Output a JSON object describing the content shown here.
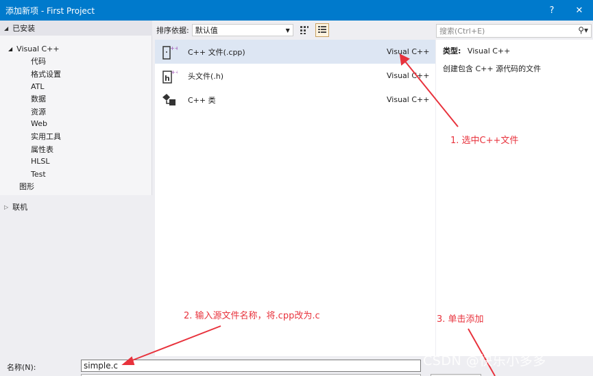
{
  "window": {
    "title": "添加新项 - First Project",
    "help_label": "?",
    "close_label": "✕"
  },
  "left_panel": {
    "installed_label": "已安装",
    "tree": {
      "root": "Visual C++",
      "children": [
        "代码",
        "格式设置",
        "ATL",
        "数据",
        "资源",
        "Web",
        "实用工具",
        "属性表",
        "HLSL",
        "Test"
      ],
      "graphics": "图形"
    },
    "online_label": "联机"
  },
  "toolbar": {
    "sort_label": "排序依据:",
    "sort_value": "默认值"
  },
  "search": {
    "placeholder": "搜索(Ctrl+E)"
  },
  "templates": [
    {
      "name": "C++ 文件(.cpp)",
      "language": "Visual C++",
      "icon": "cpp-file-icon",
      "selected": true
    },
    {
      "name": "头文件(.h)",
      "language": "Visual C++",
      "icon": "header-file-icon",
      "selected": false
    },
    {
      "name": "C++ 类",
      "language": "Visual C++",
      "icon": "cpp-class-icon",
      "selected": false
    }
  ],
  "details": {
    "type_key": "类型:",
    "type_value": "Visual C++",
    "description": "创建包含 C++ 源代码的文件"
  },
  "name_field": {
    "label": "名称(N):",
    "value": "simple.c"
  },
  "annotations": {
    "step1": "1. 选中C++文件",
    "step2": "2. 输入源文件名称，将.cpp改为.c",
    "step3": "3. 单击添加"
  },
  "watermark": "CSDN @快乐小多多",
  "colors": {
    "titlebar": "#007acc",
    "annotation": "#e8323c",
    "selected_row": "#dde6f3"
  }
}
